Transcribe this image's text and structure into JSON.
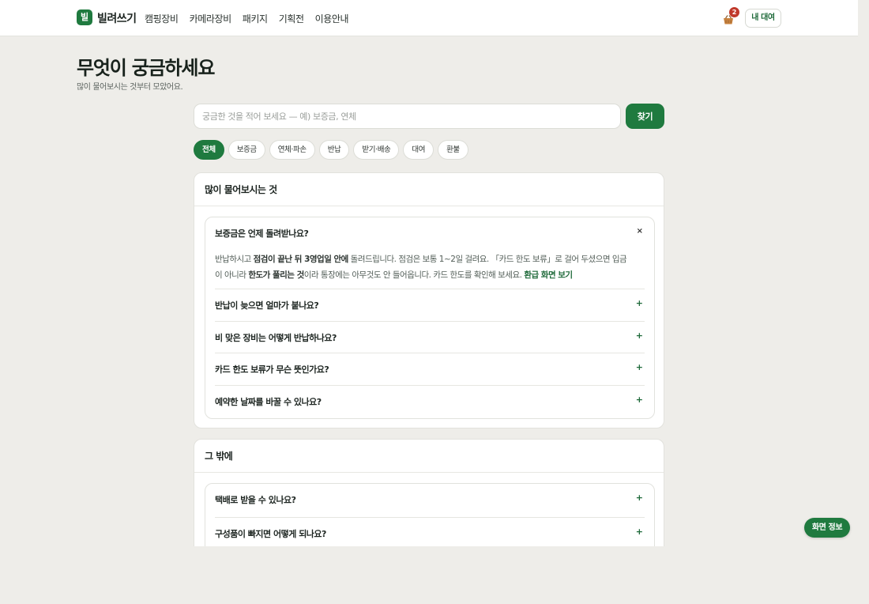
{
  "header": {
    "logo_mark": "빌",
    "logo_text": "빌려쓰기",
    "nav": [
      "캠핑장비",
      "카메라장비",
      "패키지",
      "기획전",
      "이용안내"
    ],
    "cart_count": "2",
    "my_rental_label": "내 대여"
  },
  "page": {
    "title": "무엇이 궁금하세요",
    "subtitle": "많이 물어보시는 것부터 모았어요."
  },
  "search": {
    "placeholder": "궁금한 것을 적어 보세요 — 예) 보증금, 연체",
    "button_label": "찾기"
  },
  "chips": [
    "전체",
    "보증금",
    "연체·파손",
    "반납",
    "받기·배송",
    "대여",
    "환불"
  ],
  "sections": [
    {
      "title": "많이 물어보시는 것",
      "items": [
        {
          "question": "보증금은 언제 돌려받나요?",
          "open": true,
          "answer_parts": [
            "반납하시고 ",
            "점검이 끝난 뒤 3영업일 안에",
            " 돌려드립니다. 점검은 보통 1~2일 걸려요. 「카드 한도 보류」로 걸어 두셨으면 입금이 아니라 ",
            "한도가 풀리는 것",
            "이라 통장에는 아무것도 안 들어옵니다. 카드 한도를 확인해 보세요. ",
            "환급 화면 보기"
          ]
        },
        {
          "question": "반납이 늦으면 얼마가 붙나요?",
          "open": false
        },
        {
          "question": "비 맞은 장비는 어떻게 반납하나요?",
          "open": false
        },
        {
          "question": "카드 한도 보류가 무슨 뜻인가요?",
          "open": false
        },
        {
          "question": "예약한 날짜를 바꿀 수 있나요?",
          "open": false
        }
      ]
    },
    {
      "title": "그 밖에",
      "items": [
        {
          "question": "택배로 받을 수 있나요?",
          "open": false
        },
        {
          "question": "구성품이 빠지면 어떻게 되나요?",
          "open": false
        }
      ]
    }
  ],
  "icons": {
    "open_toggle": "×",
    "closed_toggle": "+"
  },
  "floating_button_label": "화면 정보",
  "colors": {
    "accent": "#1f7a3f",
    "badge": "#c0392b",
    "background": "#eeede9"
  }
}
